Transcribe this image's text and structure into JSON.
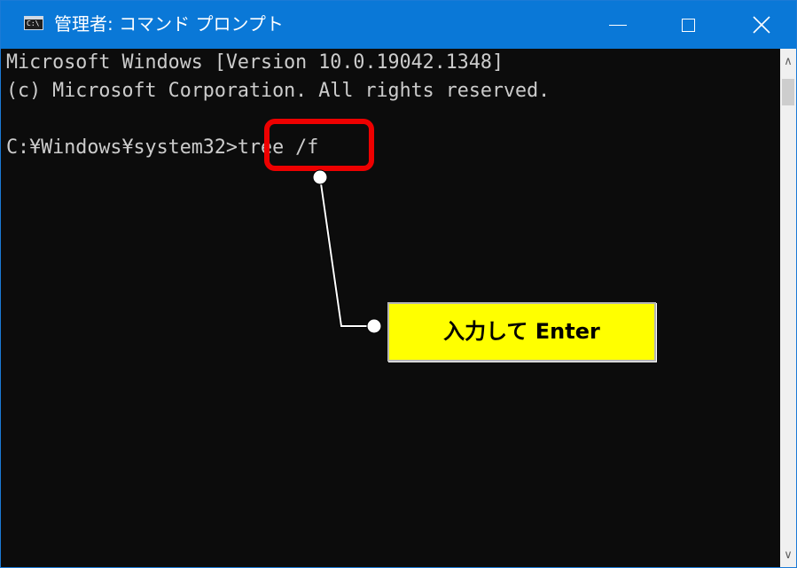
{
  "window": {
    "title": "管理者: コマンド プロンプト",
    "icon": "cmd-icon",
    "controls": {
      "minimize_icon": "minimize-icon",
      "maximize_icon": "maximize-icon",
      "close_icon": "close-icon"
    }
  },
  "console": {
    "lines": [
      "Microsoft Windows [Version 10.0.19042.1348]",
      "(c) Microsoft Corporation. All rights reserved."
    ],
    "prompt": "C:¥Windows¥system32>",
    "command": "tree /f",
    "background_color": "#0c0c0c",
    "text_color": "#cccccc"
  },
  "annotation": {
    "callout_text": "入力して Enter",
    "highlight_color": "#ee0000",
    "callout_bg_color": "#ffff00"
  },
  "scrollbar": {
    "up_icon": "scroll-up-arrow-icon",
    "down_icon": "scroll-down-arrow-icon"
  }
}
